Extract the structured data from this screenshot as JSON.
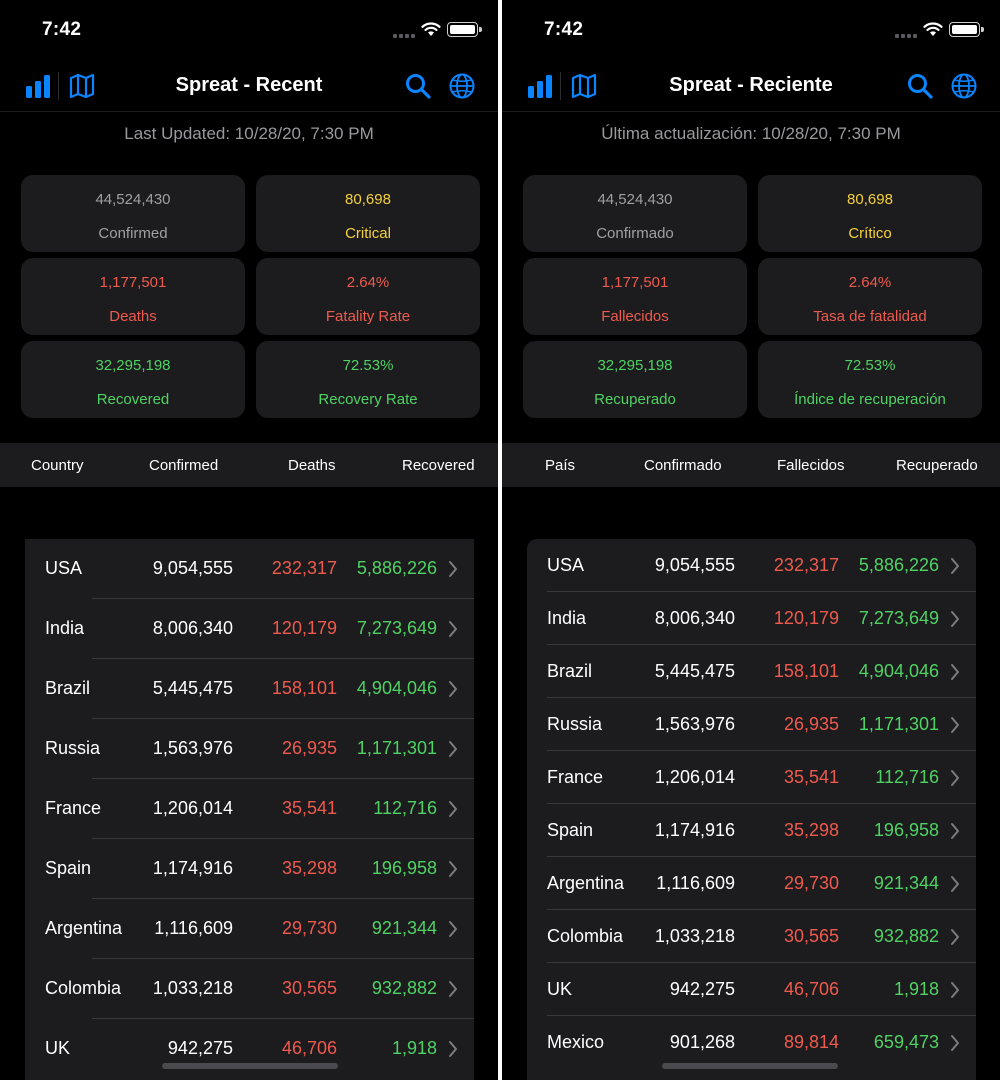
{
  "screens": [
    {
      "status_time": "7:42",
      "title": "Spreat - Recent",
      "updated": "Last Updated: 10/28/20, 7:30 PM",
      "stats": [
        {
          "value": "44,524,430",
          "label": "Confirmed"
        },
        {
          "value": "80,698",
          "label": "Critical"
        },
        {
          "value": "1,177,501",
          "label": "Deaths"
        },
        {
          "value": "2.64%",
          "label": "Fatality Rate"
        },
        {
          "value": "32,295,198",
          "label": "Recovered"
        },
        {
          "value": "72.53%",
          "label": "Recovery Rate"
        }
      ],
      "headers": [
        "Country",
        "Confirmed",
        "Deaths",
        "Recovered"
      ],
      "rows": [
        {
          "country": "USA",
          "confirmed": "9,054,555",
          "deaths": "232,317",
          "recovered": "5,886,226"
        },
        {
          "country": "India",
          "confirmed": "8,006,340",
          "deaths": "120,179",
          "recovered": "7,273,649"
        },
        {
          "country": "Brazil",
          "confirmed": "5,445,475",
          "deaths": "158,101",
          "recovered": "4,904,046"
        },
        {
          "country": "Russia",
          "confirmed": "1,563,976",
          "deaths": "26,935",
          "recovered": "1,171,301"
        },
        {
          "country": "France",
          "confirmed": "1,206,014",
          "deaths": "35,541",
          "recovered": "112,716"
        },
        {
          "country": "Spain",
          "confirmed": "1,174,916",
          "deaths": "35,298",
          "recovered": "196,958"
        },
        {
          "country": "Argentina",
          "confirmed": "1,116,609",
          "deaths": "29,730",
          "recovered": "921,344"
        },
        {
          "country": "Colombia",
          "confirmed": "1,033,218",
          "deaths": "30,565",
          "recovered": "932,882"
        },
        {
          "country": "UK",
          "confirmed": "942,275",
          "deaths": "46,706",
          "recovered": "1,918"
        }
      ]
    },
    {
      "status_time": "7:42",
      "title": "Spreat - Reciente",
      "updated": "Última actualización: 10/28/20, 7:30 PM",
      "stats": [
        {
          "value": "44,524,430",
          "label": "Confirmado"
        },
        {
          "value": "80,698",
          "label": "Crítico"
        },
        {
          "value": "1,177,501",
          "label": "Fallecidos"
        },
        {
          "value": "2.64%",
          "label": "Tasa de fatalidad"
        },
        {
          "value": "32,295,198",
          "label": "Recuperado"
        },
        {
          "value": "72.53%",
          "label": "Índice de recuperación"
        }
      ],
      "headers": [
        "País",
        "Confirmado",
        "Fallecidos",
        "Recuperado"
      ],
      "rows": [
        {
          "country": "USA",
          "confirmed": "9,054,555",
          "deaths": "232,317",
          "recovered": "5,886,226"
        },
        {
          "country": "India",
          "confirmed": "8,006,340",
          "deaths": "120,179",
          "recovered": "7,273,649"
        },
        {
          "country": "Brazil",
          "confirmed": "5,445,475",
          "deaths": "158,101",
          "recovered": "4,904,046"
        },
        {
          "country": "Russia",
          "confirmed": "1,563,976",
          "deaths": "26,935",
          "recovered": "1,171,301"
        },
        {
          "country": "France",
          "confirmed": "1,206,014",
          "deaths": "35,541",
          "recovered": "112,716"
        },
        {
          "country": "Spain",
          "confirmed": "1,174,916",
          "deaths": "35,298",
          "recovered": "196,958"
        },
        {
          "country": "Argentina",
          "confirmed": "1,116,609",
          "deaths": "29,730",
          "recovered": "921,344"
        },
        {
          "country": "Colombia",
          "confirmed": "1,033,218",
          "deaths": "30,565",
          "recovered": "932,882"
        },
        {
          "country": "UK",
          "confirmed": "942,275",
          "deaths": "46,706",
          "recovered": "1,918"
        },
        {
          "country": "Mexico",
          "confirmed": "901,268",
          "deaths": "89,814",
          "recovered": "659,473"
        }
      ]
    }
  ],
  "icons": {
    "left": [
      "bar-chart-icon",
      "map-icon"
    ],
    "right": [
      "search-icon",
      "globe-icon"
    ],
    "row": "chevron-right-icon"
  },
  "colors": {
    "accent": "#0a84ff",
    "confirmed": "#a0a0a4",
    "critical": "#f5d13a",
    "deaths": "#ef5a4e",
    "recovered": "#4fd264"
  }
}
